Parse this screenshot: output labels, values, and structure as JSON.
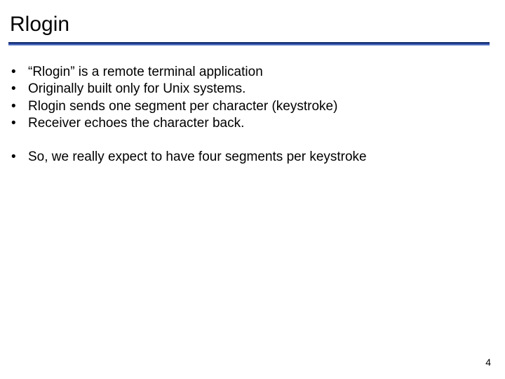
{
  "title": "Rlogin",
  "bullets_a": [
    "“Rlogin” is a remote terminal application",
    "Originally built only for Unix systems.",
    "Rlogin sends one segment per character (keystroke)",
    "Receiver echoes the character back."
  ],
  "bullets_b": [
    "So, we really expect to have four segments per keystroke"
  ],
  "page_number": "4",
  "bullet_glyph": "•"
}
